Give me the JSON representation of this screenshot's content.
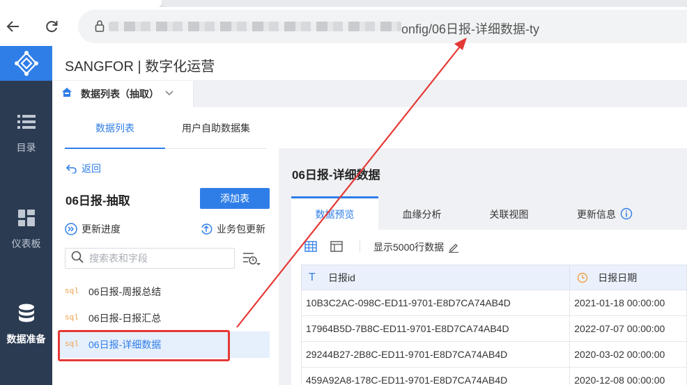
{
  "browser": {
    "url_visible": "onfig/06日报-详细数据-ty"
  },
  "app": {
    "brand": "SANGFOR | 数字化运营",
    "selector_label": "数据列表（抽取）"
  },
  "leftnav": {
    "items": [
      {
        "label": "目录",
        "icon": "list-icon"
      },
      {
        "label": "仪表板",
        "icon": "dashboard-grid-icon"
      },
      {
        "label": "数据准备",
        "icon": "database-icon"
      }
    ]
  },
  "left_panel": {
    "tabs": [
      "数据列表",
      "用户自助数据集"
    ],
    "back_label": "返回",
    "title": "06日报-抽取",
    "add_button": "添加表",
    "update_progress": "更新进度",
    "package_update": "业务包更新",
    "search_placeholder": "搜索表和字段",
    "sql_tag": "sql",
    "datasets": [
      {
        "name": "06日报-周报总结"
      },
      {
        "name": "06日报-日报汇总"
      },
      {
        "name": "06日报-详细数据",
        "selected": true
      }
    ]
  },
  "right_panel": {
    "title": "06日报-详细数据",
    "tabs": [
      "数据预览",
      "血缘分析",
      "关联视图",
      "更新信息"
    ],
    "rows_label": "显示5000行数据",
    "columns": [
      {
        "name": "日报id",
        "type_icon": "text-type-icon"
      },
      {
        "name": "日报日期",
        "type_icon": "clock-type-icon"
      }
    ],
    "rows": [
      [
        "10B3C2AC-098C-ED11-9701-E8D7CA74AB4D",
        "2021-01-18 00:00:00"
      ],
      [
        "17964B5D-7B8C-ED11-9701-E8D7CA74AB4D",
        "2022-07-07 00:00:00"
      ],
      [
        "29244B27-2B8C-ED11-9701-E8D7CA74AB4D",
        "2020-03-02 00:00:00"
      ],
      [
        "459A92A8-178C-ED11-9701-E8D7CA74AB4D",
        "2020-12-08 00:00:00"
      ]
    ]
  },
  "colors": {
    "accent": "#2f7ee8",
    "nav_bg": "#2b3b52",
    "annotation": "#e53935",
    "sql_tag": "#f0a046"
  }
}
